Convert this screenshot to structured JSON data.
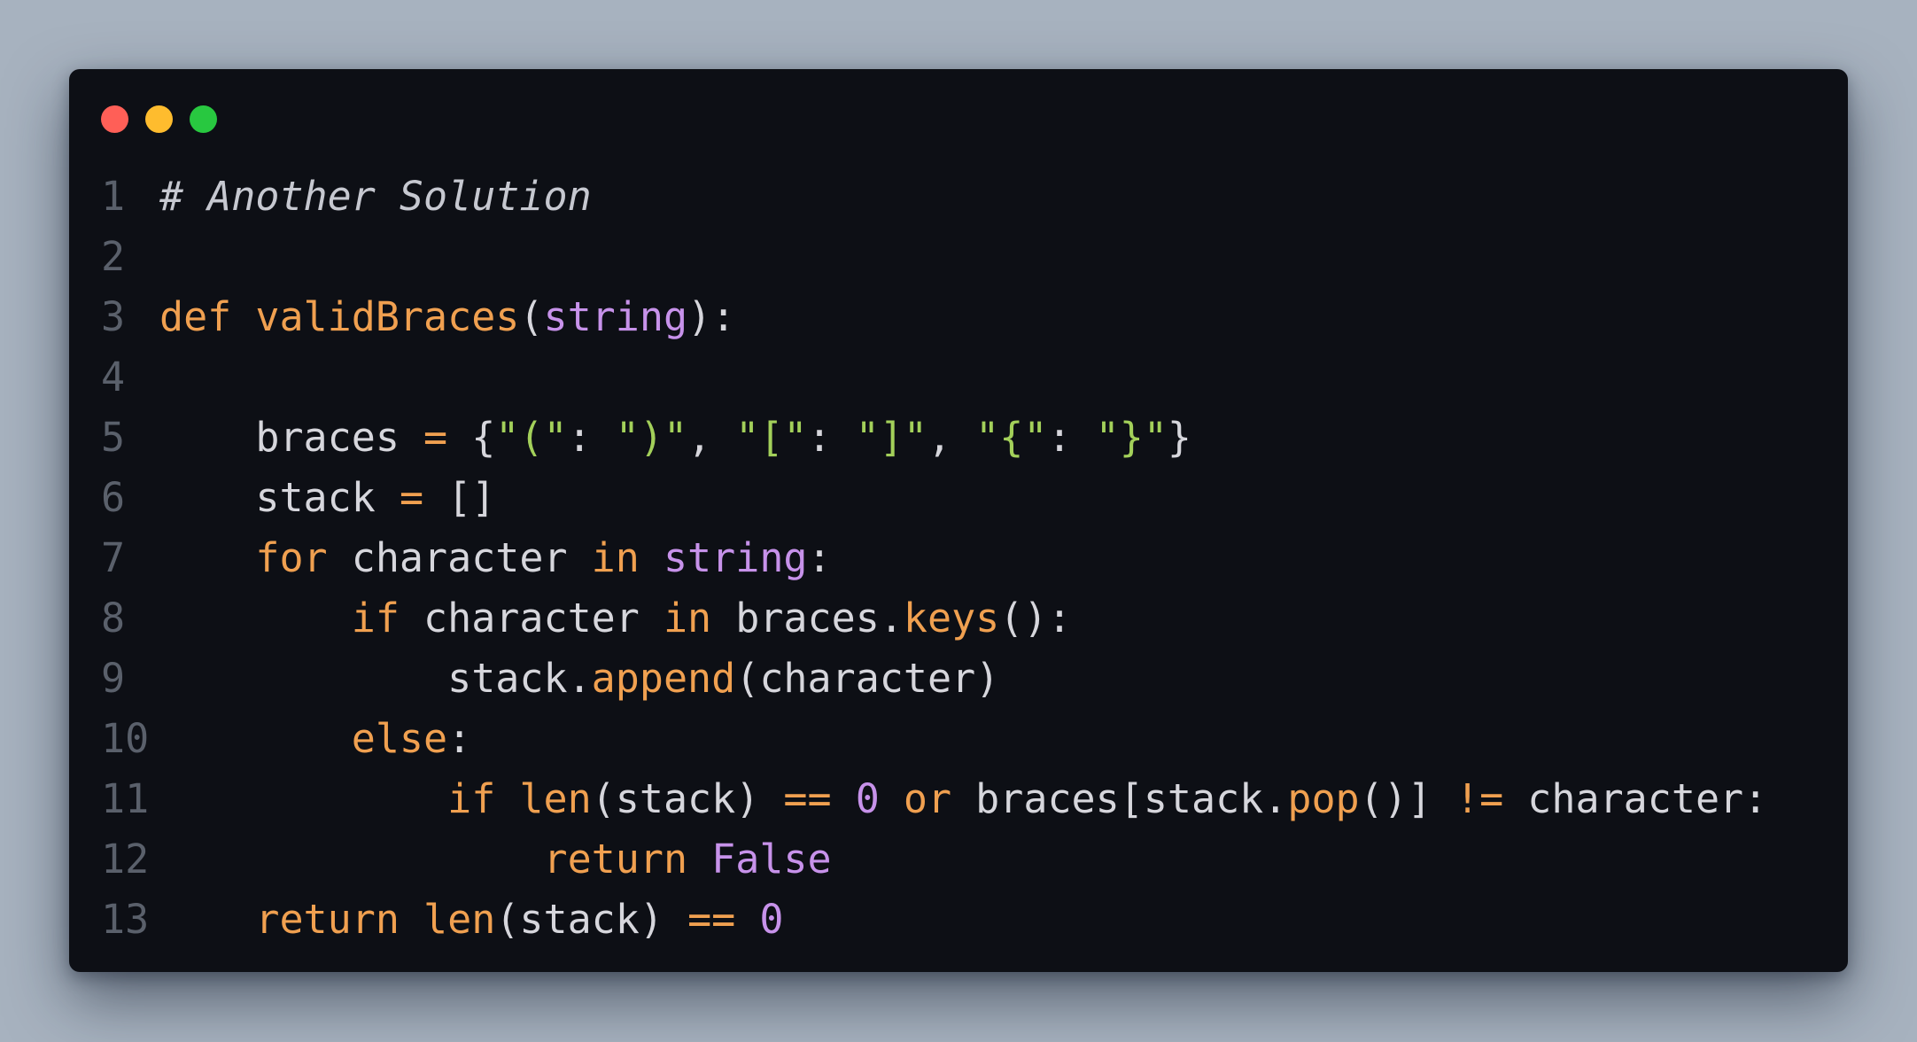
{
  "window": {
    "controls": [
      {
        "name": "close-button",
        "color": "#ff5f57"
      },
      {
        "name": "minimize-button",
        "color": "#febc2e"
      },
      {
        "name": "maximize-button",
        "color": "#28c840"
      }
    ]
  },
  "colors": {
    "background": "#a7b2bf",
    "editor": "#0d0f15",
    "plain": "#d6d6dc",
    "comment": "#c6c8d0",
    "keyword": "#f0a050",
    "function": "#f0a050",
    "param": "#c792ea",
    "string": "#a3d05a",
    "number": "#c792ea",
    "constant": "#c792ea",
    "operator": "#f0a050",
    "bool": "#c792ea",
    "gutter": "#5a606b"
  },
  "code": {
    "language": "python",
    "lines": [
      {
        "n": "1",
        "tokens": [
          {
            "t": "# Another Solution",
            "k": "comment"
          }
        ]
      },
      {
        "n": "2",
        "tokens": []
      },
      {
        "n": "3",
        "tokens": [
          {
            "t": "def",
            "k": "keyword"
          },
          {
            "t": " ",
            "k": "plain"
          },
          {
            "t": "validBraces",
            "k": "function"
          },
          {
            "t": "(",
            "k": "plain"
          },
          {
            "t": "string",
            "k": "param"
          },
          {
            "t": "):",
            "k": "plain"
          }
        ]
      },
      {
        "n": "4",
        "tokens": []
      },
      {
        "n": "5",
        "tokens": [
          {
            "t": "    braces ",
            "k": "plain"
          },
          {
            "t": "=",
            "k": "operator"
          },
          {
            "t": " {",
            "k": "plain"
          },
          {
            "t": "\"(\"",
            "k": "string"
          },
          {
            "t": ": ",
            "k": "plain"
          },
          {
            "t": "\")\"",
            "k": "string"
          },
          {
            "t": ", ",
            "k": "plain"
          },
          {
            "t": "\"[\"",
            "k": "string"
          },
          {
            "t": ": ",
            "k": "plain"
          },
          {
            "t": "\"]\"",
            "k": "string"
          },
          {
            "t": ", ",
            "k": "plain"
          },
          {
            "t": "\"{\"",
            "k": "string"
          },
          {
            "t": ": ",
            "k": "plain"
          },
          {
            "t": "\"}\"",
            "k": "string"
          },
          {
            "t": "}",
            "k": "plain"
          }
        ]
      },
      {
        "n": "6",
        "tokens": [
          {
            "t": "    stack ",
            "k": "plain"
          },
          {
            "t": "=",
            "k": "operator"
          },
          {
            "t": " []",
            "k": "plain"
          }
        ]
      },
      {
        "n": "7",
        "tokens": [
          {
            "t": "    ",
            "k": "plain"
          },
          {
            "t": "for",
            "k": "keyword"
          },
          {
            "t": " character ",
            "k": "plain"
          },
          {
            "t": "in",
            "k": "keyword"
          },
          {
            "t": " ",
            "k": "plain"
          },
          {
            "t": "string",
            "k": "param"
          },
          {
            "t": ":",
            "k": "plain"
          }
        ]
      },
      {
        "n": "8",
        "tokens": [
          {
            "t": "        ",
            "k": "plain"
          },
          {
            "t": "if",
            "k": "keyword"
          },
          {
            "t": " character ",
            "k": "plain"
          },
          {
            "t": "in",
            "k": "keyword"
          },
          {
            "t": " braces.",
            "k": "plain"
          },
          {
            "t": "keys",
            "k": "function"
          },
          {
            "t": "():",
            "k": "plain"
          }
        ]
      },
      {
        "n": "9",
        "tokens": [
          {
            "t": "            stack.",
            "k": "plain"
          },
          {
            "t": "append",
            "k": "function"
          },
          {
            "t": "(character)",
            "k": "plain"
          }
        ]
      },
      {
        "n": "10",
        "tokens": [
          {
            "t": "        ",
            "k": "plain"
          },
          {
            "t": "else",
            "k": "keyword"
          },
          {
            "t": ":",
            "k": "plain"
          }
        ]
      },
      {
        "n": "11",
        "tokens": [
          {
            "t": "            ",
            "k": "plain"
          },
          {
            "t": "if",
            "k": "keyword"
          },
          {
            "t": " ",
            "k": "plain"
          },
          {
            "t": "len",
            "k": "function"
          },
          {
            "t": "(stack) ",
            "k": "plain"
          },
          {
            "t": "==",
            "k": "operator"
          },
          {
            "t": " ",
            "k": "plain"
          },
          {
            "t": "0",
            "k": "number"
          },
          {
            "t": " ",
            "k": "plain"
          },
          {
            "t": "or",
            "k": "keyword"
          },
          {
            "t": " braces[stack.",
            "k": "plain"
          },
          {
            "t": "pop",
            "k": "function"
          },
          {
            "t": "()] ",
            "k": "plain"
          },
          {
            "t": "!=",
            "k": "operator"
          },
          {
            "t": " character:",
            "k": "plain"
          }
        ]
      },
      {
        "n": "12",
        "tokens": [
          {
            "t": "                ",
            "k": "plain"
          },
          {
            "t": "return",
            "k": "keyword"
          },
          {
            "t": " ",
            "k": "plain"
          },
          {
            "t": "False",
            "k": "bool"
          }
        ]
      },
      {
        "n": "13",
        "tokens": [
          {
            "t": "    ",
            "k": "plain"
          },
          {
            "t": "return",
            "k": "keyword"
          },
          {
            "t": " ",
            "k": "plain"
          },
          {
            "t": "len",
            "k": "function"
          },
          {
            "t": "(stack) ",
            "k": "plain"
          },
          {
            "t": "==",
            "k": "operator"
          },
          {
            "t": " ",
            "k": "plain"
          },
          {
            "t": "0",
            "k": "number"
          }
        ]
      }
    ]
  }
}
